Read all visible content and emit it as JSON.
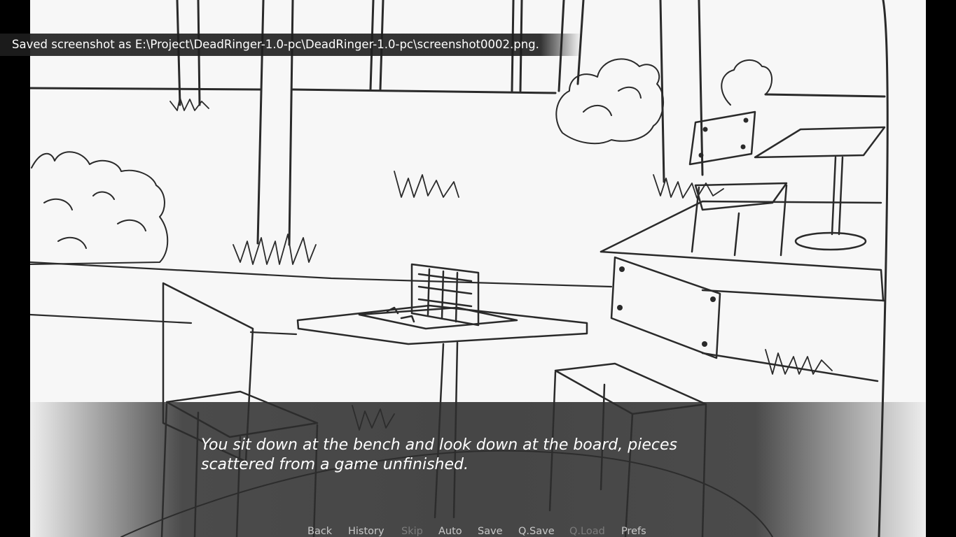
{
  "notification": {
    "text": "Saved screenshot as E:\\Project\\DeadRinger-1.0-pc\\DeadRinger-1.0-pc\\screenshot0002.png."
  },
  "dialogue": {
    "text": "You sit down at the bench and look down at the board, pieces scattered from a game unfinished."
  },
  "quick_menu": {
    "back": "Back",
    "history": "History",
    "skip": "Skip",
    "auto": "Auto",
    "save": "Save",
    "qsave": "Q.Save",
    "qload": "Q.Load",
    "prefs": "Prefs"
  },
  "colors": {
    "background": "#000000",
    "sketch_paper": "#f7f7f7",
    "sketch_line": "#2a2a2a",
    "textbox": "#2d2d2d",
    "menu_enabled": "#c9c9c9",
    "menu_disabled": "#7c7c7c"
  }
}
